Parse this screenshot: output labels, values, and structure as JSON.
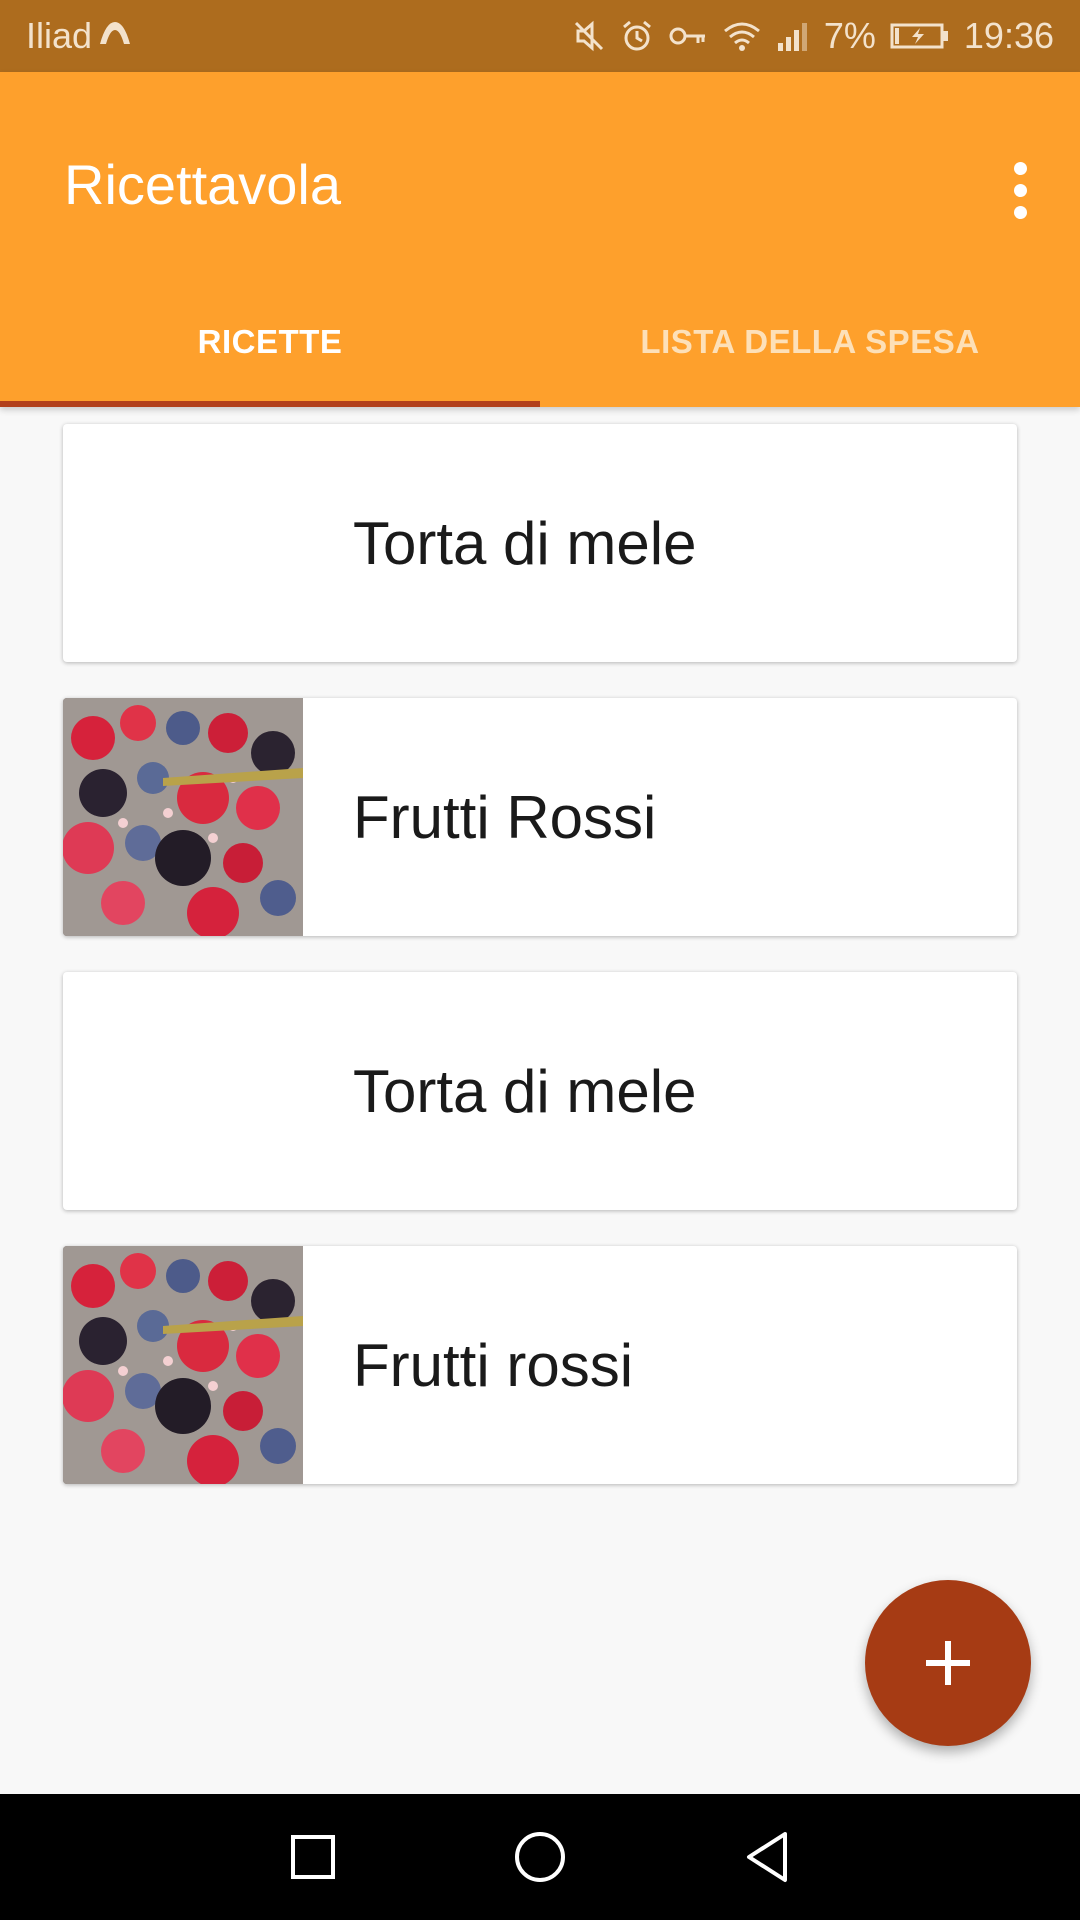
{
  "status_bar": {
    "carrier": "Iliad",
    "battery": "7%",
    "time": "19:36",
    "icons": [
      "mute-icon",
      "alarm-icon",
      "vpn-key-icon",
      "wifi-icon",
      "signal-icon",
      "battery-charging-icon"
    ]
  },
  "app_bar": {
    "title": "Ricettavola",
    "menu_icon": "more-vert-icon"
  },
  "tabs": [
    {
      "label": "RICETTE",
      "active": true
    },
    {
      "label": "LISTA DELLA SPESA",
      "active": false
    }
  ],
  "recipes": [
    {
      "title": "Torta di mele",
      "has_image": false
    },
    {
      "title": "Frutti Rossi",
      "has_image": true
    },
    {
      "title": "Torta di mele",
      "has_image": false
    },
    {
      "title": "Frutti rossi",
      "has_image": true
    }
  ],
  "fab": {
    "icon": "plus-icon"
  },
  "nav_bar": {
    "icons": [
      "recents-square-icon",
      "home-circle-icon",
      "back-triangle-icon"
    ]
  },
  "colors": {
    "status_bar": "#ad6c1e",
    "primary": "#fea02c",
    "accent": "#a63b14",
    "tab_indicator": "#b2401c",
    "background": "#f8f8f8"
  }
}
